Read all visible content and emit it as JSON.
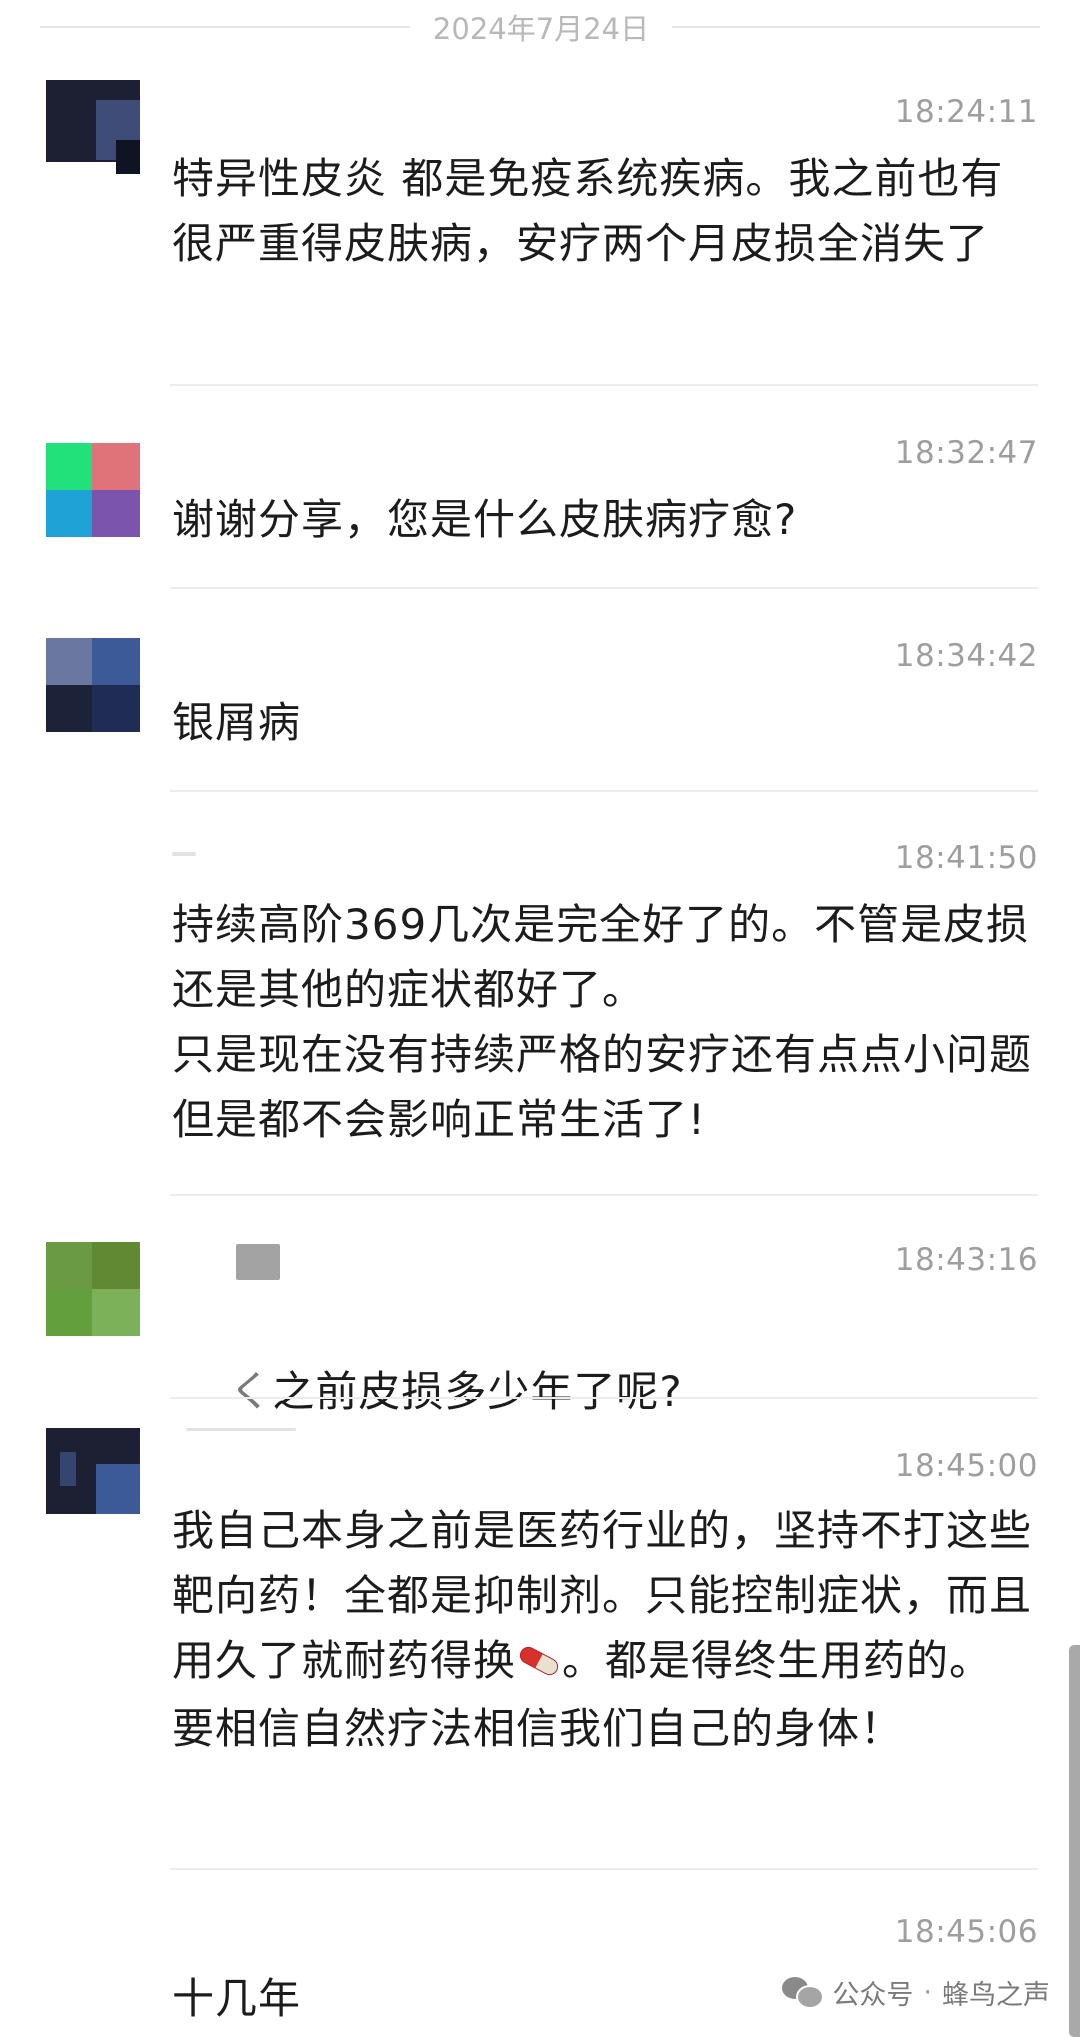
{
  "date_separator": "2024年7月24日",
  "messages": [
    {
      "time": "18:24:11",
      "text": "特异性皮炎 都是免疫系统疾病。我之前也有很严重得皮肤病，安疗两个月皮损全消失了"
    },
    {
      "time": "18:32:47",
      "text": "谢谢分享，您是什么皮肤病疗愈?"
    },
    {
      "time": "18:34:42",
      "text": "银屑病"
    },
    {
      "time": "18:41:50",
      "text": "持续高阶369几次是完全好了的。不管是皮损还是其他的症状都好了。\n只是现在没有持续严格的安疗还有点点小问题　但是都不会影响正常生活了!"
    },
    {
      "time": "18:43:16",
      "text": "之前皮损多少年了呢?"
    },
    {
      "time": "18:45:00",
      "text_before_emoji": "我自己本身之前是医药行业的，坚持不打这些靶向药！全都是抑制剂。只能控制症状，而且用久了就耐药得换",
      "emoji": "pill-icon",
      "text_after_emoji": "。都是得终生用药的。要相信自然疗法相信我们自己的身体！"
    },
    {
      "time": "18:45:06",
      "text": "十几年"
    }
  ],
  "watermark": {
    "prefix": "公众号",
    "separator": "·",
    "name": "蜂鸟之声",
    "icon": "wechat-icon"
  }
}
